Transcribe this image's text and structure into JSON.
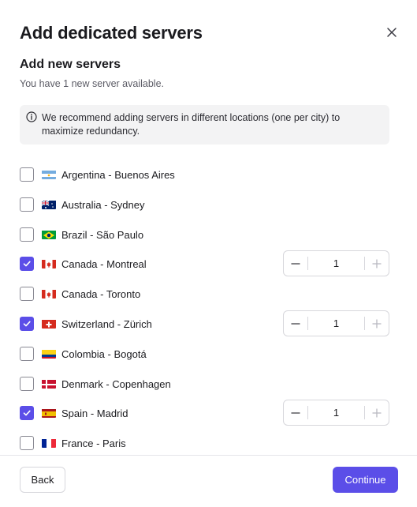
{
  "dialog": {
    "title": "Add dedicated servers",
    "subtitle": "Add new servers",
    "description": "You have 1 new server available.",
    "notice": "We recommend adding servers in different locations (one per city) to maximize redundancy."
  },
  "colors": {
    "accent": "#5b4ee8"
  },
  "locations": [
    {
      "label": "Argentina - Buenos Aires",
      "checked": false,
      "flag": "argentina-flag-icon"
    },
    {
      "label": "Australia - Sydney",
      "checked": false,
      "flag": "australia-flag-icon"
    },
    {
      "label": "Brazil - São Paulo",
      "checked": false,
      "flag": "brazil-flag-icon"
    },
    {
      "label": "Canada - Montreal",
      "checked": true,
      "flag": "canada-flag-icon",
      "quantity": "1"
    },
    {
      "label": "Canada - Toronto",
      "checked": false,
      "flag": "canada-flag-icon"
    },
    {
      "label": "Switzerland - Zürich",
      "checked": true,
      "flag": "switzerland-flag-icon",
      "quantity": "1"
    },
    {
      "label": "Colombia - Bogotá",
      "checked": false,
      "flag": "colombia-flag-icon"
    },
    {
      "label": "Denmark - Copenhagen",
      "checked": false,
      "flag": "denmark-flag-icon"
    },
    {
      "label": "Spain - Madrid",
      "checked": true,
      "flag": "spain-flag-icon",
      "quantity": "1"
    },
    {
      "label": "France - Paris",
      "checked": false,
      "flag": "france-flag-icon"
    }
  ],
  "footer": {
    "back_label": "Back",
    "continue_label": "Continue"
  }
}
